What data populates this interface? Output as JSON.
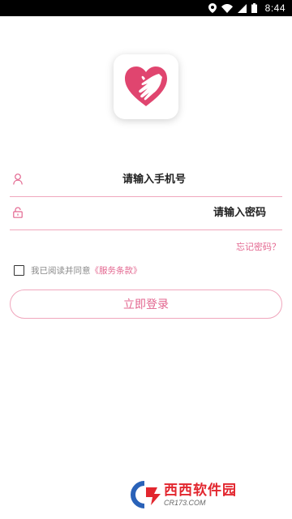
{
  "status_bar": {
    "time": "8:44"
  },
  "login": {
    "phone_placeholder": "请输入手机号",
    "password_placeholder": "请输入密码",
    "forgot_password": "忘记密码？",
    "agree_text": "我已阅读并同意",
    "terms_link": "《服务条款》",
    "login_button": "立即登录"
  },
  "watermark": {
    "title": "西西软件园",
    "subtitle": "CR173.COM"
  },
  "colors": {
    "accent_pink": "#e3668f",
    "border_pink": "#f0a7bd",
    "heart": "#e0456f"
  }
}
